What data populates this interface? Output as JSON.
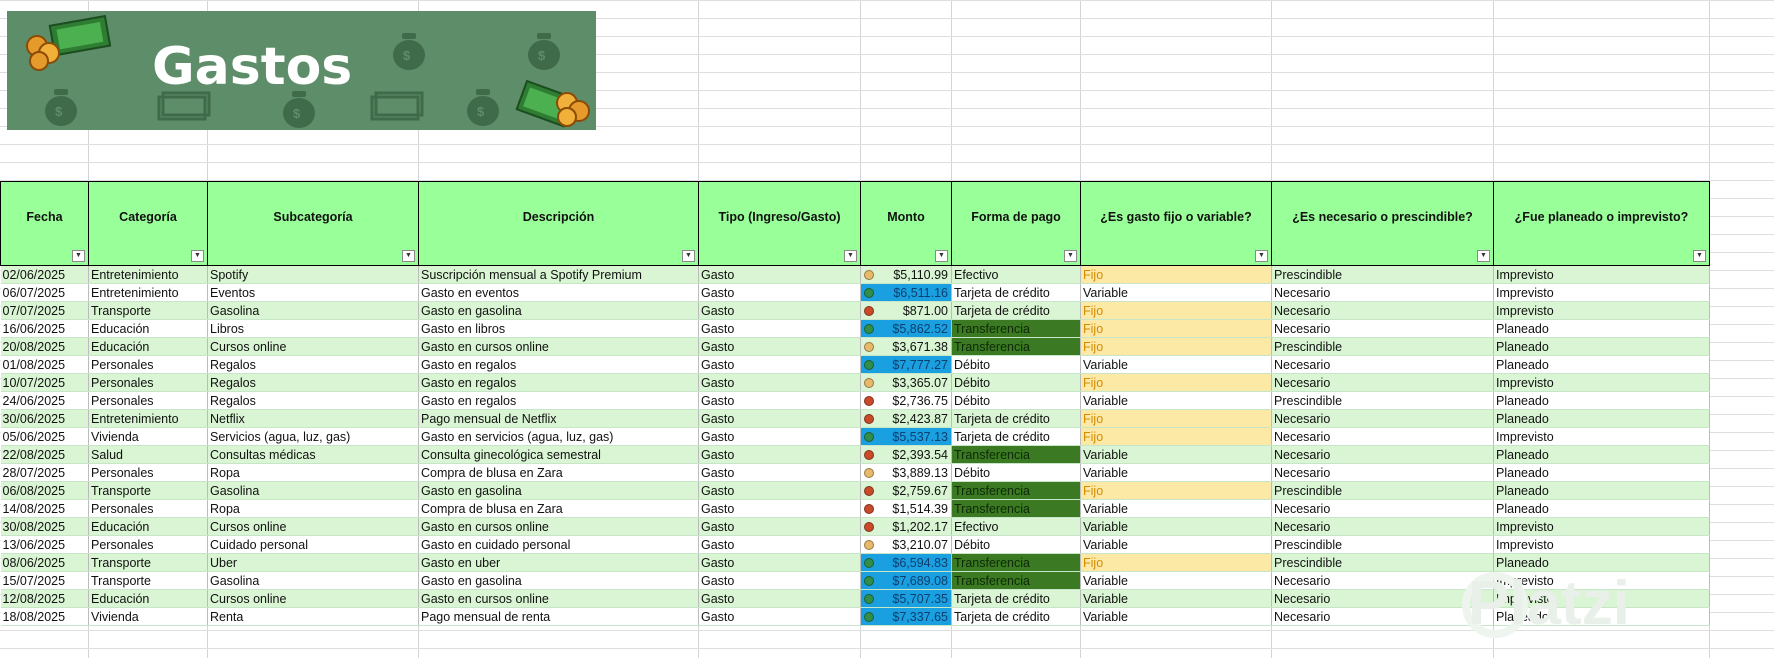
{
  "banner": {
    "title": "Gastos"
  },
  "watermark": "Platzi",
  "colors": {
    "dot_green": "#2f8f4a",
    "dot_yellow": "#e7b96a",
    "dot_red": "#c94a2a",
    "monto_high": "#1aa0e0",
    "transferencia": "#3b7a22",
    "fijo": "#fde9a6"
  },
  "table": {
    "headers": [
      "Fecha",
      "Categoría",
      "Subcategoría",
      "Descripción",
      "Tipo (Ingreso/Gasto)",
      "Monto",
      "Forma de pago",
      "¿Es gasto fijo o variable?",
      "¿Es necesario o prescindible?",
      "¿Fue planeado o imprevisto?"
    ],
    "rows": [
      {
        "fecha": "02/06/2025",
        "categoria": "Entretenimiento",
        "subcategoria": "Spotify",
        "descripcion": "Suscripción mensual a Spotify Premium",
        "tipo": "Gasto",
        "monto": "$5,110.99",
        "dot": "yellow",
        "forma": "Efectivo",
        "fijo": "Fijo",
        "necesario": "Prescindible",
        "planeado": "Imprevisto"
      },
      {
        "fecha": "06/07/2025",
        "categoria": "Entretenimiento",
        "subcategoria": "Eventos",
        "descripcion": "Gasto en eventos",
        "tipo": "Gasto",
        "monto": "$6,511.16",
        "dot": "green",
        "forma": "Tarjeta de crédito",
        "fijo": "Variable",
        "necesario": "Necesario",
        "planeado": "Imprevisto"
      },
      {
        "fecha": "07/07/2025",
        "categoria": "Transporte",
        "subcategoria": "Gasolina",
        "descripcion": "Gasto en gasolina",
        "tipo": "Gasto",
        "monto": "$871.00",
        "dot": "red",
        "forma": "Tarjeta de crédito",
        "fijo": "Fijo",
        "necesario": "Necesario",
        "planeado": "Imprevisto"
      },
      {
        "fecha": "16/06/2025",
        "categoria": "Educación",
        "subcategoria": "Libros",
        "descripcion": "Gasto en libros",
        "tipo": "Gasto",
        "monto": "$5,862.52",
        "dot": "green",
        "forma": "Transferencia",
        "fijo": "Fijo",
        "necesario": "Necesario",
        "planeado": "Planeado"
      },
      {
        "fecha": "20/08/2025",
        "categoria": "Educación",
        "subcategoria": "Cursos online",
        "descripcion": "Gasto en cursos online",
        "tipo": "Gasto",
        "monto": "$3,671.38",
        "dot": "yellow",
        "forma": "Transferencia",
        "fijo": "Fijo",
        "necesario": "Prescindible",
        "planeado": "Planeado"
      },
      {
        "fecha": "01/08/2025",
        "categoria": "Personales",
        "subcategoria": "Regalos",
        "descripcion": "Gasto en regalos",
        "tipo": "Gasto",
        "monto": "$7,777.27",
        "dot": "green",
        "forma": "Débito",
        "fijo": "Variable",
        "necesario": "Necesario",
        "planeado": "Planeado"
      },
      {
        "fecha": "10/07/2025",
        "categoria": "Personales",
        "subcategoria": "Regalos",
        "descripcion": "Gasto en regalos",
        "tipo": "Gasto",
        "monto": "$3,365.07",
        "dot": "yellow",
        "forma": "Débito",
        "fijo": "Fijo",
        "necesario": "Necesario",
        "planeado": "Imprevisto"
      },
      {
        "fecha": "24/06/2025",
        "categoria": "Personales",
        "subcategoria": "Regalos",
        "descripcion": "Gasto en regalos",
        "tipo": "Gasto",
        "monto": "$2,736.75",
        "dot": "red",
        "forma": "Débito",
        "fijo": "Variable",
        "necesario": "Prescindible",
        "planeado": "Planeado"
      },
      {
        "fecha": "30/06/2025",
        "categoria": "Entretenimiento",
        "subcategoria": "Netflix",
        "descripcion": "Pago mensual de Netflix",
        "tipo": "Gasto",
        "monto": "$2,423.87",
        "dot": "red",
        "forma": "Tarjeta de crédito",
        "fijo": "Fijo",
        "necesario": "Necesario",
        "planeado": "Planeado"
      },
      {
        "fecha": "05/06/2025",
        "categoria": "Vivienda",
        "subcategoria": "Servicios (agua, luz, gas)",
        "descripcion": "Gasto en servicios (agua, luz, gas)",
        "tipo": "Gasto",
        "monto": "$5,537.13",
        "dot": "green",
        "forma": "Tarjeta de crédito",
        "fijo": "Fijo",
        "necesario": "Necesario",
        "planeado": "Imprevisto"
      },
      {
        "fecha": "22/08/2025",
        "categoria": "Salud",
        "subcategoria": "Consultas médicas",
        "descripcion": "Consulta ginecológica semestral",
        "tipo": "Gasto",
        "monto": "$2,393.54",
        "dot": "red",
        "forma": "Transferencia",
        "fijo": "Variable",
        "necesario": "Necesario",
        "planeado": "Planeado"
      },
      {
        "fecha": "28/07/2025",
        "categoria": "Personales",
        "subcategoria": "Ropa",
        "descripcion": "Compra de blusa en Zara",
        "tipo": "Gasto",
        "monto": "$3,889.13",
        "dot": "yellow",
        "forma": "Débito",
        "fijo": "Variable",
        "necesario": "Necesario",
        "planeado": "Planeado"
      },
      {
        "fecha": "06/08/2025",
        "categoria": "Transporte",
        "subcategoria": "Gasolina",
        "descripcion": "Gasto en gasolina",
        "tipo": "Gasto",
        "monto": "$2,759.67",
        "dot": "red",
        "forma": "Transferencia",
        "fijo": "Fijo",
        "necesario": "Prescindible",
        "planeado": "Planeado"
      },
      {
        "fecha": "14/08/2025",
        "categoria": "Personales",
        "subcategoria": "Ropa",
        "descripcion": "Compra de blusa en Zara",
        "tipo": "Gasto",
        "monto": "$1,514.39",
        "dot": "red",
        "forma": "Transferencia",
        "fijo": "Variable",
        "necesario": "Necesario",
        "planeado": "Planeado"
      },
      {
        "fecha": "30/08/2025",
        "categoria": "Educación",
        "subcategoria": "Cursos online",
        "descripcion": "Gasto en cursos online",
        "tipo": "Gasto",
        "monto": "$1,202.17",
        "dot": "red",
        "forma": "Efectivo",
        "fijo": "Variable",
        "necesario": "Necesario",
        "planeado": "Imprevisto"
      },
      {
        "fecha": "13/06/2025",
        "categoria": "Personales",
        "subcategoria": "Cuidado personal",
        "descripcion": "Gasto en cuidado personal",
        "tipo": "Gasto",
        "monto": "$3,210.07",
        "dot": "yellow",
        "forma": "Débito",
        "fijo": "Variable",
        "necesario": "Prescindible",
        "planeado": "Imprevisto"
      },
      {
        "fecha": "08/06/2025",
        "categoria": "Transporte",
        "subcategoria": "Uber",
        "descripcion": "Gasto en uber",
        "tipo": "Gasto",
        "monto": "$6,594.83",
        "dot": "green",
        "forma": "Transferencia",
        "fijo": "Fijo",
        "necesario": "Prescindible",
        "planeado": "Planeado"
      },
      {
        "fecha": "15/07/2025",
        "categoria": "Transporte",
        "subcategoria": "Gasolina",
        "descripcion": "Gasto en gasolina",
        "tipo": "Gasto",
        "monto": "$7,689.08",
        "dot": "green",
        "forma": "Transferencia",
        "fijo": "Variable",
        "necesario": "Necesario",
        "planeado": "Imprevisto"
      },
      {
        "fecha": "12/08/2025",
        "categoria": "Educación",
        "subcategoria": "Cursos online",
        "descripcion": "Gasto en cursos online",
        "tipo": "Gasto",
        "monto": "$5,707.35",
        "dot": "green",
        "forma": "Tarjeta de crédito",
        "fijo": "Variable",
        "necesario": "Necesario",
        "planeado": "Imprevisto"
      },
      {
        "fecha": "18/08/2025",
        "categoria": "Vivienda",
        "subcategoria": "Renta",
        "descripcion": "Pago mensual de renta",
        "tipo": "Gasto",
        "monto": "$7,337.65",
        "dot": "green",
        "forma": "Tarjeta de crédito",
        "fijo": "Variable",
        "necesario": "Necesario",
        "planeado": "Planeado"
      }
    ]
  }
}
